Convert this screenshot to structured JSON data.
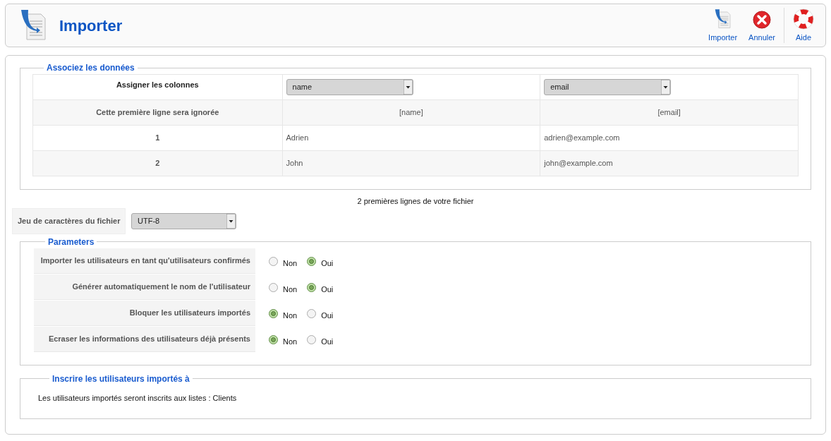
{
  "header": {
    "title": "Importer"
  },
  "toolbar": [
    {
      "kind": "import",
      "label": "Importer"
    },
    {
      "kind": "cancel",
      "label": "Annuler"
    },
    {
      "kind": "help",
      "label": "Aide"
    }
  ],
  "mapping": {
    "legend": "Associez les données",
    "assign_label": "Assigner les colonnes",
    "selects": [
      "name",
      "email"
    ],
    "rows": [
      {
        "kind": "ignored",
        "label": "Cette première ligne sera ignorée",
        "cells": [
          "[name]",
          "[email]"
        ]
      },
      {
        "kind": "data",
        "label": "1",
        "cells": [
          "Adrien",
          "adrien@example.com"
        ]
      },
      {
        "kind": "data",
        "label": "2",
        "cells": [
          "John",
          "john@example.com"
        ]
      }
    ]
  },
  "caption": "2 premières lignes de votre fichier",
  "charset": {
    "label": "Jeu de caractères du fichier",
    "value": "UTF-8"
  },
  "parameters": {
    "legend": "Parameters",
    "items": [
      {
        "label": "Importer les utilisateurs en tant qu'utilisateurs confirmés",
        "options": [
          {
            "label": "Non",
            "selected": false
          },
          {
            "label": "Oui",
            "selected": true
          }
        ]
      },
      {
        "label": "Générer automatiquement le nom de l'utilisateur",
        "options": [
          {
            "label": "Non",
            "selected": false
          },
          {
            "label": "Oui",
            "selected": true
          }
        ]
      },
      {
        "label": "Bloquer les utilisateurs importés",
        "options": [
          {
            "label": "Non",
            "selected": true
          },
          {
            "label": "Oui",
            "selected": false
          }
        ]
      },
      {
        "label": "Ecraser les informations des utilisateurs déjà présents",
        "options": [
          {
            "label": "Non",
            "selected": true
          },
          {
            "label": "Oui",
            "selected": false
          }
        ]
      }
    ]
  },
  "subscription": {
    "legend": "Inscrire les utilisateurs importés à",
    "text": "Les utilisateurs importés seront inscrits aux listes : Clients"
  }
}
